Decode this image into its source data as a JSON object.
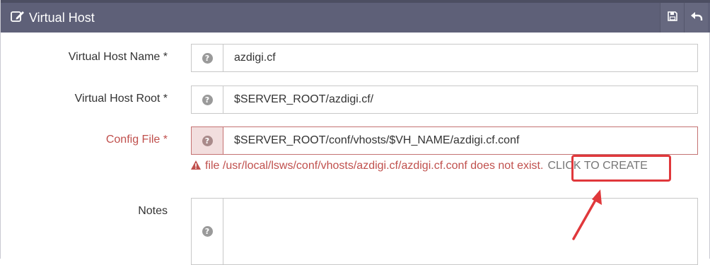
{
  "header": {
    "title": "Virtual Host",
    "edit_icon": "edit-icon",
    "save_icon": "floppy-disk-icon",
    "back_icon": "undo-arrow-icon"
  },
  "form": {
    "vhost_name": {
      "label": "Virtual Host Name *",
      "value": "azdigi.cf"
    },
    "vhost_root": {
      "label": "Virtual Host Root *",
      "value": "$SERVER_ROOT/azdigi.cf/"
    },
    "config_file": {
      "label": "Config File *",
      "value": "$SERVER_ROOT/conf/vhosts/$VH_NAME/azdigi.cf.conf",
      "error_text": "file /usr/local/lsws/conf/vhosts/azdigi.cf/azdigi.cf.conf does not exist.",
      "create_link": "CLICK TO CREATE"
    },
    "notes": {
      "label": "Notes",
      "value": ""
    },
    "help_glyph": "?"
  },
  "colors": {
    "header_bg": "#5e6078",
    "error": "#c0504d",
    "highlight": "#e0383b"
  }
}
